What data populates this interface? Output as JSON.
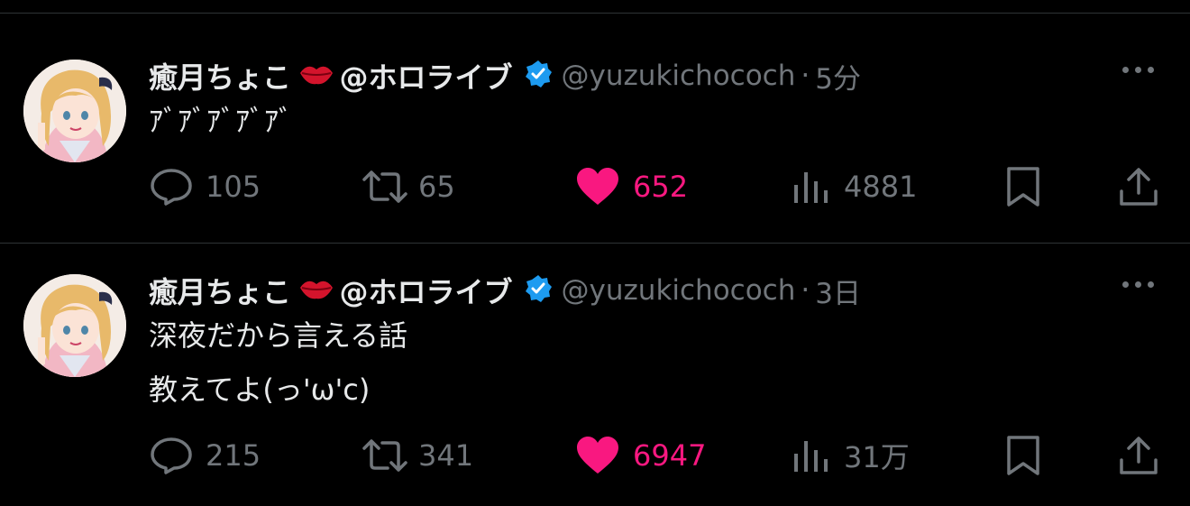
{
  "tweets": [
    {
      "display_name": "癒月ちょこ",
      "emoji": "kiss-mark-lips",
      "affiliation": "@ホロライブ",
      "verified": true,
      "handle": "@yuzukichococh",
      "separator": "·",
      "time": "5分",
      "body_lines": [
        "ｱﾞｱﾞｱﾞｱﾞｱﾞ"
      ],
      "stats": {
        "replies": "105",
        "retweets": "65",
        "likes": "652",
        "views": "4881"
      },
      "liked": true
    },
    {
      "display_name": "癒月ちょこ",
      "emoji": "kiss-mark-lips",
      "affiliation": "@ホロライブ",
      "verified": true,
      "handle": "@yuzukichococh",
      "separator": "·",
      "time": "3日",
      "body_lines": [
        "深夜だから言える話",
        "教えてよ(っ'ω'c)"
      ],
      "stats": {
        "replies": "215",
        "retweets": "341",
        "likes": "6947",
        "views": "31万"
      },
      "liked": true
    }
  ],
  "colors": {
    "background": "#000000",
    "text": "#e7e9ea",
    "muted": "#71767b",
    "like": "#f91880",
    "verified": "#1d9bf0",
    "divider": "#2f3336"
  }
}
